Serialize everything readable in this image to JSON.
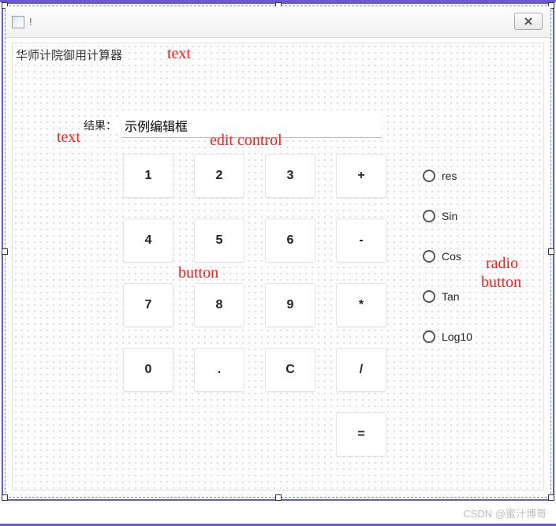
{
  "window": {
    "title": "!",
    "close_tooltip": "Close"
  },
  "header_text": "华师计院御用计算器",
  "result": {
    "label": "结果：",
    "value": "示例编辑框",
    "placeholder": ""
  },
  "buttons": {
    "r1": [
      "1",
      "2",
      "3",
      "+"
    ],
    "r2": [
      "4",
      "5",
      "6",
      "-"
    ],
    "r3": [
      "7",
      "8",
      "9",
      "*"
    ],
    "r4": [
      "0",
      ".",
      "C",
      "/"
    ],
    "eq": "="
  },
  "radios": {
    "items": [
      "res",
      "Sin",
      "Cos",
      "Tan",
      "Log10"
    ]
  },
  "annotations": {
    "text1": "text",
    "text2": "text",
    "edit": "edit control",
    "button": "button",
    "radio_l1": "radio",
    "radio_l2": "button"
  },
  "watermark": "CSDN @蜜汁博哥"
}
